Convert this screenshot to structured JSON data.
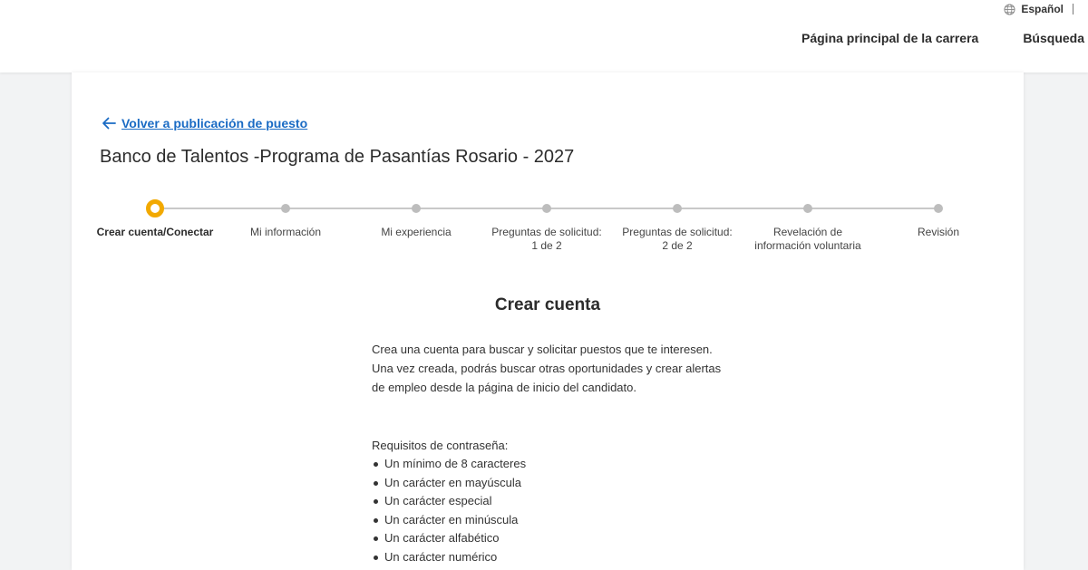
{
  "header": {
    "language": "Español",
    "language_icon": "globe-icon",
    "nav": [
      {
        "label": "Página principal de la carrera"
      },
      {
        "label": "Búsqueda"
      }
    ]
  },
  "page": {
    "back_link": "Volver a publicación de puesto",
    "back_icon": "arrow-left-icon",
    "job_title": "Banco de Talentos -Programa de Pasantías Rosario - 2027"
  },
  "stepper": {
    "active_color": "#f2a900",
    "steps": [
      {
        "label": "Crear cuenta/Conectar",
        "active": true
      },
      {
        "label": "Mi información"
      },
      {
        "label": "Mi experiencia"
      },
      {
        "label": "Preguntas de solicitud: 1 de 2"
      },
      {
        "label": "Preguntas de solicitud: 2 de 2"
      },
      {
        "label": "Revelación de información voluntaria"
      },
      {
        "label": "Revisión"
      }
    ]
  },
  "content": {
    "title": "Crear cuenta",
    "description": "Crea una cuenta para buscar y solicitar puestos que te interesen. Una vez creada, podrás buscar otras oportunidades y crear alertas de empleo desde la página de inicio del candidato.",
    "requirements_title": "Requisitos de contraseña:",
    "requirements": [
      "Un mínimo de 8 caracteres",
      "Un carácter en mayúscula",
      "Un carácter especial",
      "Un carácter en minúscula",
      "Un carácter alfabético",
      "Un carácter numérico"
    ]
  },
  "colors": {
    "link": "#1a6bc4",
    "background": "#f2f3f4"
  }
}
